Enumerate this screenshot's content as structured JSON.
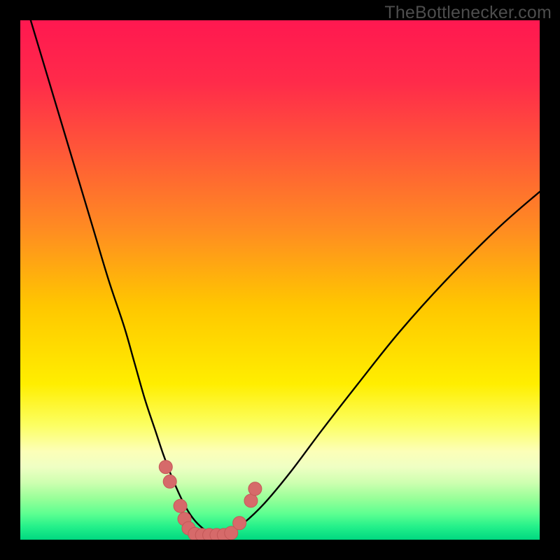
{
  "watermark": "TheBottlenecker.com",
  "colors": {
    "frame": "#000000",
    "gradient_stops": [
      {
        "offset": 0.0,
        "color": "#ff1850"
      },
      {
        "offset": 0.12,
        "color": "#ff2b4a"
      },
      {
        "offset": 0.25,
        "color": "#ff5738"
      },
      {
        "offset": 0.4,
        "color": "#ff8b22"
      },
      {
        "offset": 0.55,
        "color": "#ffc700"
      },
      {
        "offset": 0.7,
        "color": "#ffee00"
      },
      {
        "offset": 0.78,
        "color": "#fcff63"
      },
      {
        "offset": 0.83,
        "color": "#fcffb8"
      },
      {
        "offset": 0.86,
        "color": "#efffc3"
      },
      {
        "offset": 0.89,
        "color": "#ceffb0"
      },
      {
        "offset": 0.92,
        "color": "#99ff99"
      },
      {
        "offset": 0.95,
        "color": "#5dff91"
      },
      {
        "offset": 0.975,
        "color": "#24f08a"
      },
      {
        "offset": 1.0,
        "color": "#00d880"
      }
    ],
    "curve": "#000000",
    "marker_fill": "#d66a6a",
    "marker_stroke": "#c45858"
  },
  "chart_data": {
    "type": "line",
    "title": "",
    "xlabel": "",
    "ylabel": "",
    "xlim": [
      0,
      100
    ],
    "ylim": [
      0,
      100
    ],
    "series": [
      {
        "name": "bottleneck-curve",
        "x": [
          2,
          5,
          8,
          11,
          14,
          17,
          20,
          22,
          24,
          26,
          27.5,
          29,
          30.5,
          32,
          33.5,
          35,
          36.5,
          38,
          40,
          43,
          47,
          52,
          58,
          65,
          73,
          82,
          92,
          100
        ],
        "y": [
          100,
          90,
          80,
          70,
          60,
          50,
          41,
          34,
          27,
          21,
          16.5,
          12.5,
          9,
          6,
          3.8,
          2.3,
          1.3,
          1,
          1.3,
          3.2,
          7,
          13,
          21,
          30,
          40,
          50,
          60,
          67
        ]
      }
    ],
    "markers": {
      "name": "highlight-dots",
      "points": [
        {
          "x": 28.0,
          "y": 14.0
        },
        {
          "x": 28.8,
          "y": 11.2
        },
        {
          "x": 30.8,
          "y": 6.5
        },
        {
          "x": 31.6,
          "y": 4.0
        },
        {
          "x": 32.4,
          "y": 2.2
        },
        {
          "x": 33.6,
          "y": 1.1
        },
        {
          "x": 35.0,
          "y": 0.9
        },
        {
          "x": 36.4,
          "y": 0.9
        },
        {
          "x": 37.8,
          "y": 0.9
        },
        {
          "x": 39.2,
          "y": 0.9
        },
        {
          "x": 40.6,
          "y": 1.3
        },
        {
          "x": 42.2,
          "y": 3.2
        },
        {
          "x": 44.4,
          "y": 7.5
        },
        {
          "x": 45.2,
          "y": 9.8
        }
      ],
      "radius": 9.5
    }
  }
}
